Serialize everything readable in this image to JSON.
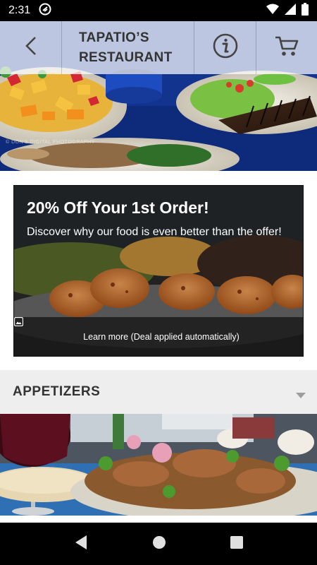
{
  "status_bar": {
    "time": "2:31",
    "icons": [
      "notification-icon",
      "wifi-icon",
      "cell-signal-icon",
      "battery-icon"
    ]
  },
  "header": {
    "back_icon": "back-arrow-icon",
    "title": "TAPATIO’S\nRESTAURANT",
    "info_icon": "info-icon",
    "cart_icon": "cart-icon"
  },
  "hero": {
    "watermark": "© DON'S DIGITAL PHOTOGRAPHY"
  },
  "promo": {
    "title": "20% Off Your 1st Order!",
    "description": "Discover why our food is even better than the offer!",
    "footer_icon": "image-icon",
    "footer_text": "Learn more (Deal applied automatically)"
  },
  "category": {
    "label": "APPETIZERS",
    "caret_icon": "caret-down-icon"
  },
  "nav_bar": {
    "icons": [
      "back-triangle-icon",
      "home-circle-icon",
      "recents-square-icon"
    ]
  },
  "colors": {
    "tablecloth_blue": "#12348f",
    "header_overlay": "#ffffffb8",
    "category_bg": "#eeeeee"
  }
}
